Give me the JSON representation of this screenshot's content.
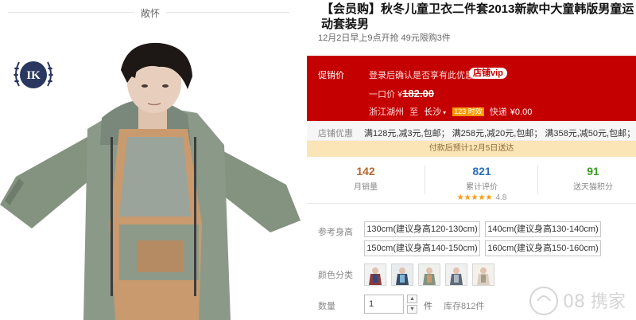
{
  "caption": "敞怀",
  "logo": {
    "letters": "IK",
    "name": "laurel-logo"
  },
  "product": {
    "title": "【会员购】秋冬儿童卫衣二件套2013新款中大童韩版男童运动套装男",
    "subtitle": "12月2日早上9点开抢 49元限购3件"
  },
  "promo": {
    "label": "促销价",
    "desc": "登录后确认是否享有此优惠",
    "vip": "店铺vip",
    "price_prefix": "一口价 ¥",
    "price": "182.00",
    "from": "浙江湖州",
    "to_label": "至",
    "to": "长沙",
    "timer": "123 时效",
    "ship_label": "快递",
    "ship_fee": "¥0.00"
  },
  "coupon": {
    "label": "店铺优惠",
    "text": "满128元,减3元,包邮； 满258元,减20元,包邮； 满358元,减50元,包邮；"
  },
  "delivery": "付款后预计12月5日送达",
  "stats": [
    {
      "num": "142",
      "label": "月销量",
      "color": "#b5672c"
    },
    {
      "num": "821",
      "label": "累计评价",
      "color": "#2c70b5"
    },
    {
      "num": "91",
      "label": "送天猫积分",
      "color": "#3a9d23"
    }
  ],
  "rating": {
    "stars": "★★★★★",
    "value": "4.8"
  },
  "sizes": {
    "label": "参考身高",
    "options": [
      "130cm(建议身高120-130cm)",
      "140cm(建议身高130-140cm)",
      "150cm(建议身高140-150cm)",
      "160cm(建议身高150-160cm)"
    ]
  },
  "colors": {
    "label": "颜色分类",
    "count": 5
  },
  "quantity": {
    "label": "数量",
    "value": "1",
    "unit": "件",
    "stock": "库存812件"
  },
  "watermark": "08 携家"
}
